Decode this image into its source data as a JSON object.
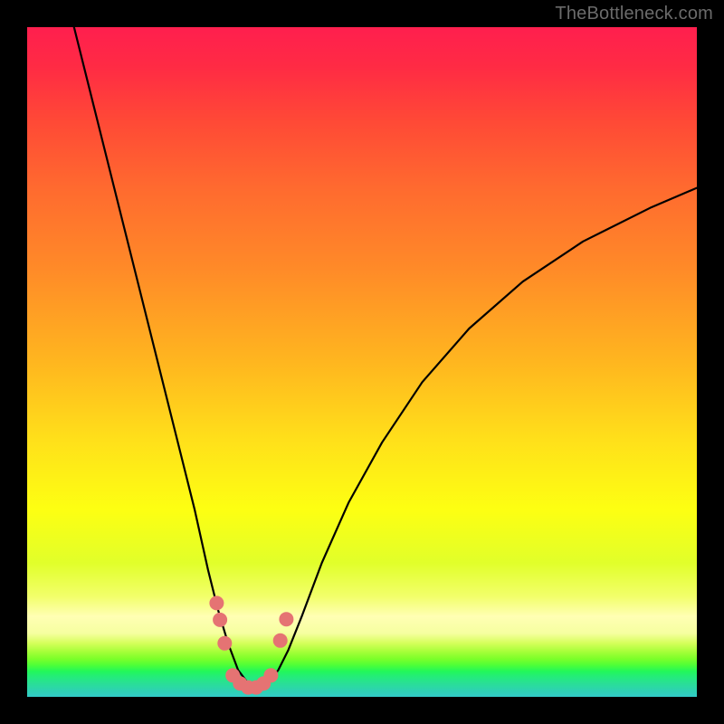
{
  "watermark": "TheBottleneck.com",
  "colors": {
    "page_bg": "#000000",
    "watermark": "#6b6b6b",
    "curve": "#000000",
    "markers": "#e57373",
    "gradient_top": "#ff1f4e",
    "gradient_bottom": "#32cbc8"
  },
  "chart_data": {
    "type": "line",
    "title": "",
    "xlabel": "",
    "ylabel": "",
    "xlim": [
      0,
      100
    ],
    "ylim": [
      0,
      100
    ],
    "grid": false,
    "legend": false,
    "series": [
      {
        "name": "curve",
        "x": [
          7,
          10,
          13,
          16,
          19,
          22,
          25,
          27,
          28.5,
          30,
          31.5,
          33,
          34.5,
          36,
          37.5,
          39,
          41,
          44,
          48,
          53,
          59,
          66,
          74,
          83,
          93,
          100
        ],
        "y": [
          100,
          88,
          76,
          64,
          52,
          40,
          28,
          19,
          13,
          8,
          4,
          2,
          1,
          2,
          4,
          7,
          12,
          20,
          29,
          38,
          47,
          55,
          62,
          68,
          73,
          76
        ]
      }
    ],
    "markers": [
      {
        "x": 28.3,
        "y": 14.0
      },
      {
        "x": 28.8,
        "y": 11.5
      },
      {
        "x": 29.5,
        "y": 8.0
      },
      {
        "x": 30.7,
        "y": 3.2
      },
      {
        "x": 31.8,
        "y": 2.0
      },
      {
        "x": 33.0,
        "y": 1.4
      },
      {
        "x": 34.2,
        "y": 1.4
      },
      {
        "x": 35.3,
        "y": 2.0
      },
      {
        "x": 36.4,
        "y": 3.2
      },
      {
        "x": 37.8,
        "y": 8.4
      },
      {
        "x": 38.7,
        "y": 11.6
      }
    ]
  }
}
